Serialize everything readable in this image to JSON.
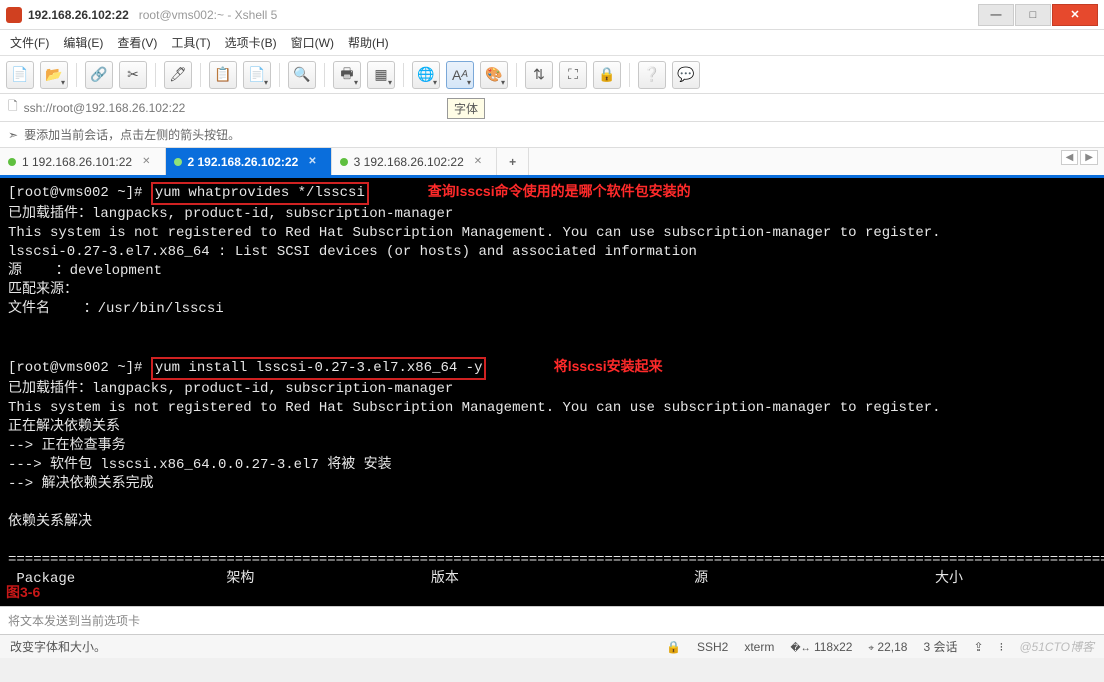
{
  "title": {
    "primary": "192.168.26.102:22",
    "secondary": "root@vms002:~ - Xshell 5"
  },
  "winbtns": {
    "min": "—",
    "max": "□",
    "close": "✕"
  },
  "menu": {
    "file": "文件(F)",
    "edit": "编辑(E)",
    "view": "查看(V)",
    "tools": "工具(T)",
    "tabs": "选项卡(B)",
    "window": "窗口(W)",
    "help": "帮助(H)"
  },
  "font_tooltip": "字体",
  "url": {
    "scheme": "ssh://root@192.168.26.102:22"
  },
  "hint": "要添加当前会话，点击左侧的箭头按钮。",
  "tabs": {
    "t1": {
      "label": "1 192.168.26.101:22"
    },
    "t2": {
      "label": "2 192.168.26.102:22"
    },
    "t3": {
      "label": "3 192.168.26.102:22"
    },
    "new": "+"
  },
  "term": {
    "prompt1": "[root@vms002 ~]# ",
    "cmd1": "yum whatprovides */lsscsi",
    "ann1": "查询lsscsi命令使用的是哪个软件包安装的",
    "out1a": "已加载插件：langpacks, product-id, subscription-manager",
    "out1b": "This system is not registered to Red Hat Subscription Management. You can use subscription-manager to register.",
    "out1c": "lsscsi-0.27-3.el7.x86_64 : List SCSI devices (or hosts) and associated information",
    "out1d": "源    ：development",
    "out1e": "匹配来源：",
    "out1f": "文件名    ：/usr/bin/lsscsi",
    "prompt2": "[root@vms002 ~]# ",
    "cmd2": "yum install lsscsi-0.27-3.el7.x86_64 -y",
    "ann2": "将lsscsi安装起来",
    "out2a": "已加载插件：langpacks, product-id, subscription-manager",
    "out2b": "This system is not registered to Red Hat Subscription Management. You can use subscription-manager to register.",
    "out2c": "正在解决依赖关系",
    "out2d": "--> 正在检查事务",
    "out2e": "---> 软件包 lsscsi.x86_64.0.0.27-3.el7 将被 安装",
    "out2f": "--> 解决依赖关系完成",
    "out2g": "",
    "out2h": "依赖关系解决",
    "sep": "===========================================================================================================================================",
    "hdr": " Package                  架构                     版本                            源                           大小",
    "fig": "图3-6"
  },
  "inputbar": "将文本发送到当前选项卡",
  "status": {
    "left": "改变字体和大小。",
    "proto": "SSH2",
    "term": "xterm",
    "size": "118x22",
    "pos": "22,18",
    "sess": "3 会话",
    "watermark": "@51CTO博客"
  },
  "icons": {
    "lock": "🔒",
    "arrow": "➣",
    "caps": "⇪",
    "num": "⁝"
  }
}
